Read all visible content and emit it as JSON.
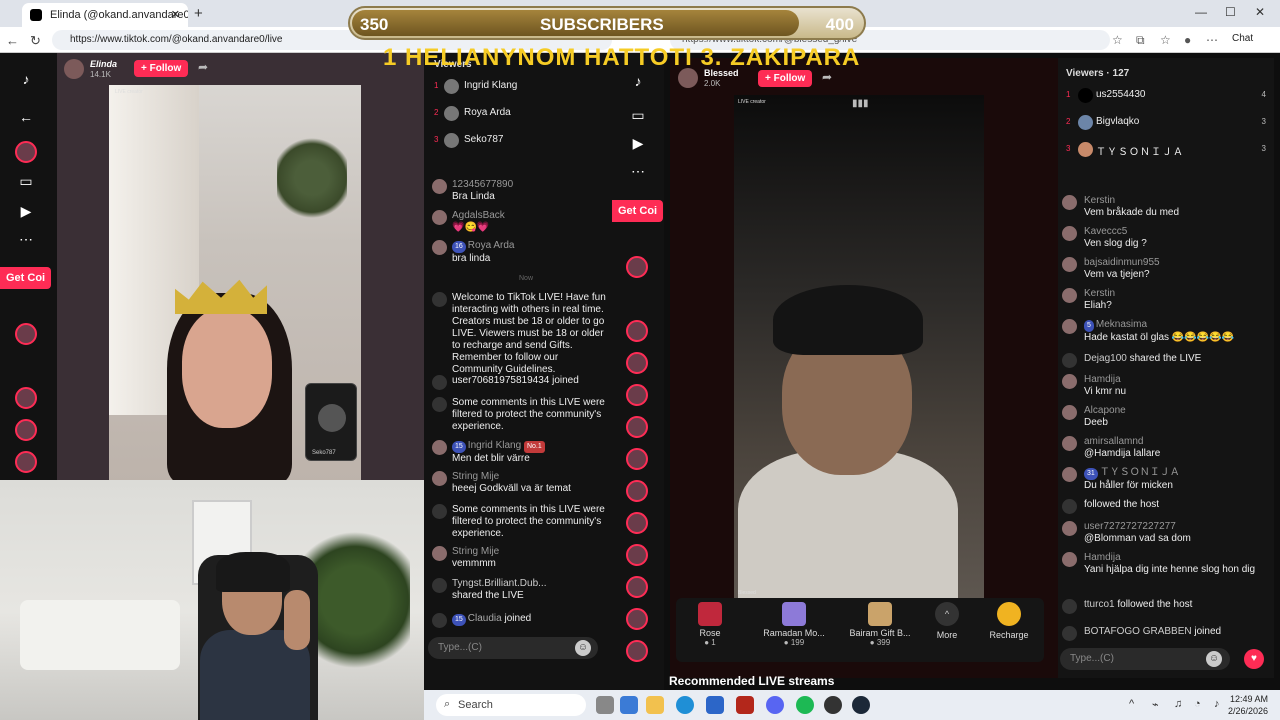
{
  "browser": {
    "tab_title": "Elinda (@okand.anvandare0) is",
    "url": "https://www.tiktok.com/@okand.anvandare0/live",
    "url2": "https://www.tiktok.com/@blessed_g/live",
    "chat_label": "Chat"
  },
  "overlay": {
    "left_num": "350",
    "title": "SUBSCRIBERS",
    "right_num": "400",
    "progress": 0.87,
    "subtitle": "1 HELIANYNOM  HATTOTI  3.  ZAKIPARA"
  },
  "left_stream": {
    "host_name": "Elinda",
    "host_likes": "14.1K",
    "follow_label": "+ Follow",
    "live_creator": "LIVE creator",
    "get_coins": "Get Coi",
    "pip_label": "Seko787"
  },
  "left_viewers": {
    "title": "Viewers",
    "items": [
      {
        "rank": "1",
        "name": "Ingrid Klang"
      },
      {
        "rank": "2",
        "name": "Roya Arda"
      },
      {
        "rank": "3",
        "name": "Seko787"
      }
    ]
  },
  "left_chat": [
    {
      "user": "12345677890",
      "text": "Bra Linda"
    },
    {
      "user": "AgdalsBack",
      "text": "💗😋💗"
    },
    {
      "user": "Roya Arda",
      "badge": "16",
      "text": "bra linda"
    }
  ],
  "left_now": "Now",
  "left_system": [
    {
      "text": "Welcome to TikTok LIVE! Have fun interacting with others in real time. Creators must be 18 or older to go LIVE. Viewers must be 18 or older to recharge and send Gifts. Remember to follow our Community Guidelines."
    },
    {
      "user": "user70681975819434",
      "text": "joined"
    },
    {
      "text": "Some comments in this LIVE were filtered to protect the community's experience."
    },
    {
      "user": "Ingrid Klang",
      "badge": "15",
      "tag": "No.1",
      "text": "Men det blir värre"
    },
    {
      "user": "String Mije",
      "text": "heeej Godkväll va är temat"
    },
    {
      "text": "Some comments in this LIVE were filtered to protect the community's experience."
    },
    {
      "user": "String Mije",
      "text": "vemmmm"
    },
    {
      "user": "Tyngst.Brilliant.Dub...",
      "text": "shared the LIVE"
    },
    {
      "user": "Claudia",
      "badge": "15",
      "text": "joined"
    }
  ],
  "left_input_placeholder": "Type...(C)",
  "right_stream": {
    "host_name": "Blessed",
    "host_likes": "2.0K",
    "follow_label": "+ Follow",
    "live_creator": "LIVE creator",
    "get_coins": "Get Coi",
    "cam_label": "Blessed"
  },
  "gifts": [
    {
      "name": "Rose",
      "price": "1",
      "color": "#c0283c"
    },
    {
      "name": "Ramadan Mo...",
      "price": "199",
      "color": "#8d7ad8"
    },
    {
      "name": "Bairam Gift B...",
      "price": "399",
      "color": "#caa36a"
    }
  ],
  "gifts_more": "More",
  "gifts_recharge": "Recharge",
  "recommended": "Recommended LIVE streams",
  "right_viewers": {
    "title": "Viewers",
    "count": "127",
    "items": [
      {
        "rank": "1",
        "name": "us2554430",
        "count": "4"
      },
      {
        "rank": "2",
        "name": "Bigvlaqko",
        "count": "3"
      },
      {
        "rank": "3",
        "name": "ＴＹＳＯＮＩＪＡ",
        "count": "3"
      }
    ]
  },
  "right_chat": [
    {
      "user": "Kerstin",
      "text": "Vem bråkade du med"
    },
    {
      "user": "Kaveccc5",
      "text": "Ven slog dig ?"
    },
    {
      "user": "bajsaidinmun955",
      "text": "Vem va tjejen?"
    },
    {
      "user": "Kerstin",
      "text": "Eliah?"
    },
    {
      "user": "Meknasima",
      "badge": "5",
      "text": "Hade kastat öl glas 😂😂😂😂😂"
    },
    {
      "user": "Dejag100",
      "text": "shared the LIVE",
      "inline": true
    },
    {
      "user": "Hamdija",
      "text": "Vi kmr nu"
    },
    {
      "user": "Alcapone",
      "text": "Deeb"
    },
    {
      "user": "amirsallamnd",
      "text": "@Hamdija lallare"
    },
    {
      "user": "ＴＹＳＯＮＩＪＡ",
      "badge": "31",
      "text": "Du håller för micken"
    },
    {
      "user": "",
      "text": "followed the host",
      "inline": true
    },
    {
      "user": "user7272727227277",
      "text": "@Blomman vad sa dom"
    },
    {
      "user": "Hamdija",
      "text": "Yani hjälpa dig inte henne slog hon dig"
    },
    {
      "user": "tturco1",
      "text": "followed the host",
      "inline": true
    },
    {
      "user": "BOTAFOGO GRABBEN",
      "text": "joined",
      "inline": true
    }
  ],
  "right_input_placeholder": "Type...(C)",
  "taskbar": {
    "search": "Search",
    "time": "12:49 AM",
    "date": "2/26/2026"
  }
}
